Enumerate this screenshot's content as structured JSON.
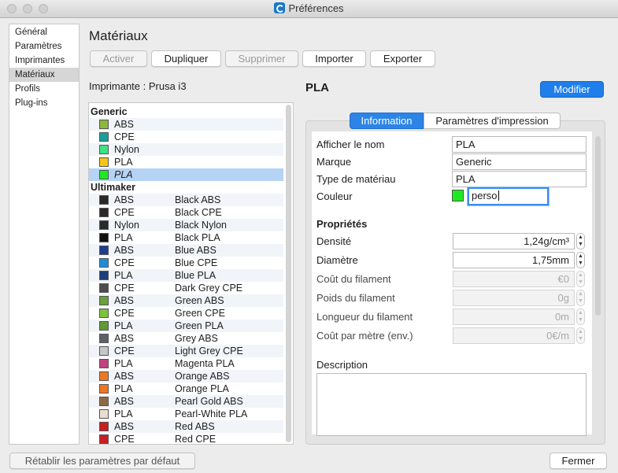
{
  "window": {
    "title": "Préférences"
  },
  "sidebar": {
    "items": [
      {
        "label": "Général"
      },
      {
        "label": "Paramètres"
      },
      {
        "label": "Imprimantes"
      },
      {
        "label": "Matériaux"
      },
      {
        "label": "Profils"
      },
      {
        "label": "Plug-ins"
      }
    ],
    "selected": "Matériaux"
  },
  "heading": "Matériaux",
  "toolbar": {
    "activate": "Activer",
    "duplicate": "Dupliquer",
    "remove": "Supprimer",
    "import": "Importer",
    "export": "Exporter"
  },
  "printer_label": "Imprimante : Prusa i3",
  "materials": [
    {
      "kind": "group",
      "label": "Generic"
    },
    {
      "type": "ABS",
      "color": "#8fb83a"
    },
    {
      "type": "CPE",
      "color": "#179f9b"
    },
    {
      "type": "Nylon",
      "color": "#3fe186"
    },
    {
      "type": "PLA",
      "color": "#f5c518"
    },
    {
      "type": "PLA",
      "color": "#1eea21",
      "selected": true
    },
    {
      "kind": "group",
      "label": "Ultimaker"
    },
    {
      "type": "ABS",
      "name": "Black ABS",
      "color": "#2a2a2a"
    },
    {
      "type": "CPE",
      "name": "Black CPE",
      "color": "#2a2a2a"
    },
    {
      "type": "Nylon",
      "name": "Black Nylon",
      "color": "#2a2a2a"
    },
    {
      "type": "PLA",
      "name": "Black PLA",
      "color": "#111111"
    },
    {
      "type": "ABS",
      "name": "Blue ABS",
      "color": "#1e3e8c"
    },
    {
      "type": "CPE",
      "name": "Blue CPE",
      "color": "#1e8fd6"
    },
    {
      "type": "PLA",
      "name": "Blue PLA",
      "color": "#1c3f7a"
    },
    {
      "type": "CPE",
      "name": "Dark Grey CPE",
      "color": "#4d4d4d"
    },
    {
      "type": "ABS",
      "name": "Green ABS",
      "color": "#67a03c"
    },
    {
      "type": "CPE",
      "name": "Green CPE",
      "color": "#7cc142"
    },
    {
      "type": "PLA",
      "name": "Green PLA",
      "color": "#5f9a36"
    },
    {
      "type": "ABS",
      "name": "Grey ABS",
      "color": "#5e6066"
    },
    {
      "type": "CPE",
      "name": "Light Grey CPE",
      "color": "#c6c6c6"
    },
    {
      "type": "PLA",
      "name": "Magenta PLA",
      "color": "#c0427f"
    },
    {
      "type": "ABS",
      "name": "Orange ABS",
      "color": "#ec7a24"
    },
    {
      "type": "PLA",
      "name": "Orange PLA",
      "color": "#ee7623"
    },
    {
      "type": "ABS",
      "name": "Pearl Gold ABS",
      "color": "#8b6a43"
    },
    {
      "type": "PLA",
      "name": "Pearl-White PLA",
      "color": "#e8ddd0"
    },
    {
      "type": "ABS",
      "name": "Red ABS",
      "color": "#c81e24"
    },
    {
      "type": "CPE",
      "name": "Red CPE",
      "color": "#c71f22"
    }
  ],
  "material_title": "PLA",
  "modify_label": "Modifier",
  "tabs": [
    {
      "label": "Information",
      "active": true
    },
    {
      "label": "Paramètres d'impression",
      "active": false
    }
  ],
  "info": {
    "display_name_label": "Afficher le nom",
    "display_name": "PLA",
    "brand_label": "Marque",
    "brand": "Generic",
    "type_label": "Type de matériau",
    "type": "PLA",
    "color_label": "Couleur",
    "color_value": "perso",
    "color_hex": "#1eea21"
  },
  "properties": {
    "title": "Propriétés",
    "density_label": "Densité",
    "density": "1,24g/cm³",
    "diameter_label": "Diamètre",
    "diameter": "1,75mm",
    "cost_label": "Coût du filament",
    "cost": "€0",
    "weight_label": "Poids du filament",
    "weight": "0g",
    "length_label": "Longueur du filament",
    "length": "0m",
    "cost_per_meter_label": "Coût par mètre (env.)",
    "cost_per_meter": "0€/m"
  },
  "description_label": "Description",
  "footer": {
    "reset": "Rétablir les paramètres par défaut",
    "close": "Fermer"
  }
}
